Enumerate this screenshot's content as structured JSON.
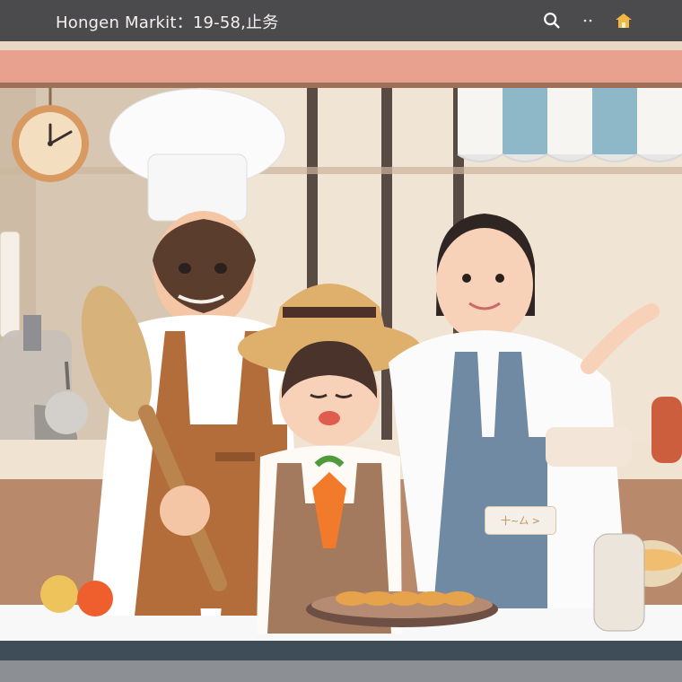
{
  "window": {
    "title": "Hongen Markit：19-58,止务"
  },
  "toolbar": {
    "icons": [
      "search-icon",
      "dots-icon",
      "home-icon"
    ]
  },
  "scene": {
    "sign_text": "十~厶 >",
    "clock_label": "clock",
    "colors": {
      "topbar": "#4b4a4c",
      "awning_pink": "#e8a18f",
      "apron_brown": "#b36d3b",
      "apron_blue": "#6f8aa2",
      "carrot": "#f27a2b"
    }
  }
}
